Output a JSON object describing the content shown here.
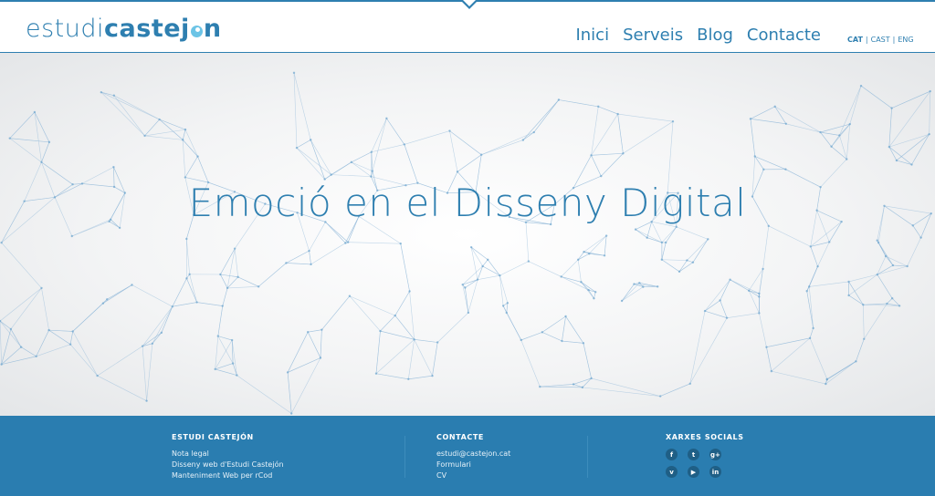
{
  "header": {
    "logo": {
      "part1": "estudi",
      "part2": "castej",
      "part3": "n"
    },
    "nav": [
      "Inici",
      "Serveis",
      "Blog",
      "Contacte"
    ],
    "languages": {
      "cat": "CAT",
      "cast": "CAST",
      "eng": "ENG",
      "separator": "|"
    },
    "accent_color": "#2e7fb0"
  },
  "hero": {
    "title": "Emoció en el Disseny Digital"
  },
  "footer": {
    "background": "#2a7db0",
    "col1": {
      "heading": "ESTUDI CASTEJÓN",
      "links": [
        "Nota legal",
        "Disseny web d'Estudi Castejón",
        "Manteniment Web per rCod"
      ]
    },
    "col2": {
      "heading": "CONTACTE",
      "links": [
        "estudi@castejon.cat",
        "Formulari",
        "CV"
      ]
    },
    "col3": {
      "heading": "XARXES SOCIALS",
      "icons": [
        {
          "name": "facebook-icon",
          "glyph": "f"
        },
        {
          "name": "twitter-icon",
          "glyph": "t"
        },
        {
          "name": "google-plus-icon",
          "glyph": "g+"
        },
        {
          "name": "vimeo-icon",
          "glyph": "v"
        },
        {
          "name": "youtube-icon",
          "glyph": "▶"
        },
        {
          "name": "linkedin-icon",
          "glyph": "in"
        }
      ]
    }
  }
}
